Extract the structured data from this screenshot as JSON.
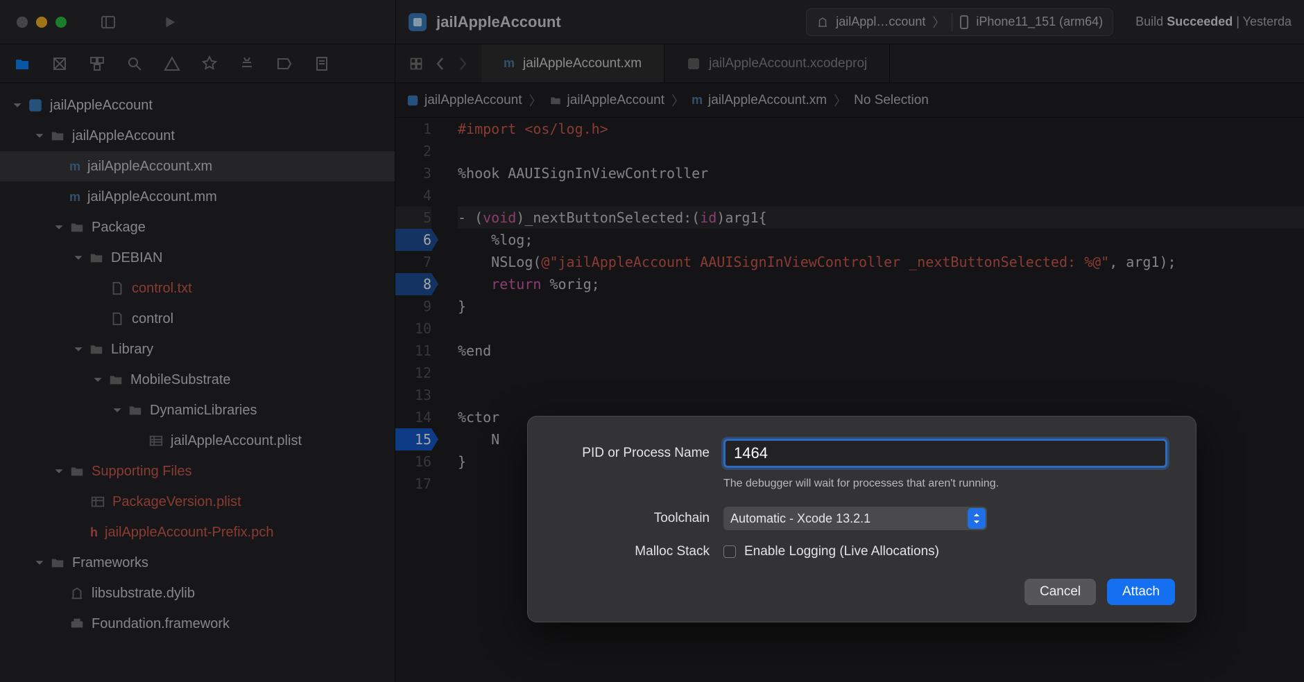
{
  "titlebar": {
    "project_name": "jailAppleAccount",
    "scheme_target": "jailAppl…ccount",
    "scheme_device": "iPhone11_151 (arm64)",
    "build_status_prefix": "Build ",
    "build_status_result": "Succeeded",
    "build_status_sep": " | ",
    "build_status_time": "Yesterda"
  },
  "tabs": {
    "active": "jailAppleAccount.xm",
    "inactive": "jailAppleAccount.xcodeproj"
  },
  "breadcrumb": {
    "c1": "jailAppleAccount",
    "c2": "jailAppleAccount",
    "c3": "jailAppleAccount.xm",
    "c4": "No Selection"
  },
  "tree": {
    "root": "jailAppleAccount",
    "folder1": "jailAppleAccount",
    "file_xm": "jailAppleAccount.xm",
    "file_mm": "jailAppleAccount.mm",
    "package": "Package",
    "debian": "DEBIAN",
    "control_txt": "control.txt",
    "control": "control",
    "library": "Library",
    "mobilesubstrate": "MobileSubstrate",
    "dynlib": "DynamicLibraries",
    "plist": "jailAppleAccount.plist",
    "supporting": "Supporting Files",
    "pkgver": "PackageVersion.plist",
    "prefix": "jailAppleAccount-Prefix.pch",
    "frameworks": "Frameworks",
    "libsub": "libsubstrate.dylib",
    "foundation": "Foundation.framework"
  },
  "code": {
    "l1_a": "#import ",
    "l1_b": "<os/log.h>",
    "l3": "%hook AAUISignInViewController",
    "l5_a": "- (",
    "l5_b": "void",
    "l5_c": ")_nextButtonSelected:(",
    "l5_d": "id",
    "l5_e": ")arg1{",
    "l6": "    %log;",
    "l7_a": "    NSLog(",
    "l7_b": "@\"jailAppleAccount AAUISignInViewController _nextButtonSelected: %@\"",
    "l7_c": ", arg1);",
    "l8_a": "    ",
    "l8_b": "return",
    "l8_c": " %orig;",
    "l9": "}",
    "l11": "%end",
    "l14": "%ctor",
    "l15": "    N",
    "l16": "}"
  },
  "lines": {
    "n1": "1",
    "n2": "2",
    "n3": "3",
    "n4": "4",
    "n5": "5",
    "n6": "6",
    "n7": "7",
    "n8": "8",
    "n9": "9",
    "n10": "10",
    "n11": "11",
    "n12": "12",
    "n13": "13",
    "n14": "14",
    "n15": "15",
    "n16": "16",
    "n17": "17"
  },
  "dialog": {
    "pid_label": "PID or Process Name",
    "pid_value": "1464 ",
    "hint": "The debugger will wait for processes that aren't running.",
    "toolchain_label": "Toolchain",
    "toolchain_value": "Automatic - Xcode 13.2.1",
    "malloc_label": "Malloc Stack",
    "malloc_check": "Enable Logging (Live Allocations)",
    "cancel": "Cancel",
    "attach": "Attach"
  }
}
